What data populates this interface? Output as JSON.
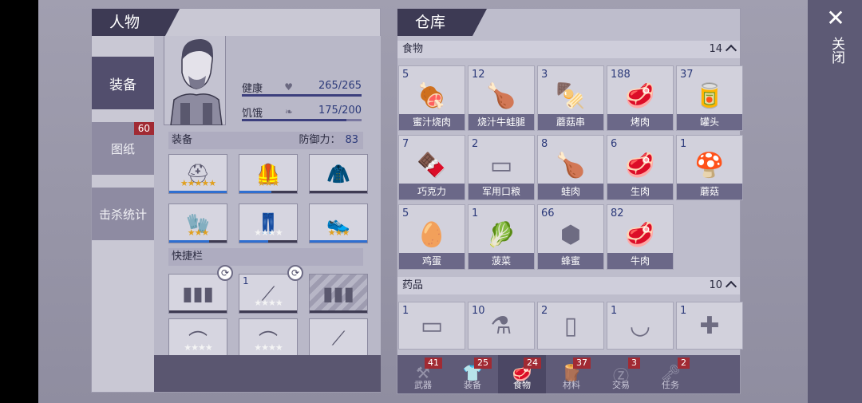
{
  "character": {
    "title": "人物",
    "tabs": [
      {
        "label": "装备",
        "active": true,
        "badge": ""
      },
      {
        "label": "图纸",
        "active": false,
        "badge": "60"
      },
      {
        "label": "击杀统计",
        "active": false,
        "badge": ""
      }
    ],
    "stats": {
      "health": {
        "label": "健康",
        "value": "265/265",
        "fraction": 1.0,
        "icon": "heart-icon"
      },
      "hunger": {
        "label": "饥饿",
        "value": "175/200",
        "fraction": 0.875,
        "icon": "stomach-icon"
      }
    },
    "equipment": {
      "label": "装备",
      "defense_label": "防御力：",
      "defense_value": "83",
      "slots": [
        {
          "item": "helmet-icon",
          "stars": "★★★★★",
          "gold": true,
          "durability": 1.0
        },
        {
          "item": "armor-vest-icon",
          "stars": "★★★",
          "gold": true,
          "durability": 0.55
        },
        {
          "item": "jacket-icon",
          "stars": "",
          "gold": false,
          "durability": 0
        },
        {
          "item": "gloves-icon",
          "stars": "★★★",
          "gold": true,
          "durability": 0.7
        },
        {
          "item": "pants-icon",
          "stars": "★★★★",
          "gold": false,
          "durability": 0.5
        },
        {
          "item": "shoes-icon",
          "stars": "★★★",
          "gold": true,
          "durability": 1.0
        }
      ]
    },
    "quickbar": {
      "label": "快捷栏",
      "slots": [
        {
          "item": "ammo-icon",
          "count": "",
          "stars": "",
          "durability": 0,
          "swap": true,
          "striped": false
        },
        {
          "item": "fire-spear-icon",
          "count": "1",
          "stars": "★★★★",
          "durability": 0,
          "swap": true,
          "striped": false
        },
        {
          "item": "ammo-icon",
          "count": "",
          "stars": "",
          "durability": 0,
          "swap": false,
          "striped": true
        },
        {
          "item": "bow-icon",
          "count": "",
          "stars": "★★★★",
          "durability": 0,
          "swap": false,
          "striped": false
        },
        {
          "item": "bow-icon",
          "count": "",
          "stars": "★★★★",
          "durability": 0.55,
          "swap": false,
          "striped": false
        },
        {
          "item": "machete-icon",
          "count": "",
          "stars": "",
          "durability": 0.12,
          "swap": false,
          "striped": false,
          "red": true
        }
      ]
    }
  },
  "warehouse": {
    "title": "仓库",
    "food": {
      "label": "食物",
      "count": "14",
      "items": [
        {
          "count": "5",
          "name": "蜜汁烧肉",
          "icon": "roast-meat-icon",
          "glyph": "🍖"
        },
        {
          "count": "12",
          "name": "烧汁牛蛙腿",
          "icon": "frog-legs-icon",
          "glyph": "🍗"
        },
        {
          "count": "3",
          "name": "蘑菇串",
          "icon": "mushroom-skewer-icon",
          "glyph": "🍢"
        },
        {
          "count": "188",
          "name": "烤肉",
          "icon": "grilled-meat-icon",
          "glyph": "🥩"
        },
        {
          "count": "37",
          "name": "罐头",
          "icon": "can-icon",
          "glyph": "🥫"
        },
        {
          "count": "7",
          "name": "巧克力",
          "icon": "chocolate-icon",
          "glyph": "🍫"
        },
        {
          "count": "2",
          "name": "军用口粮",
          "icon": "ration-icon",
          "glyph": "▭"
        },
        {
          "count": "8",
          "name": "蛙肉",
          "icon": "frog-meat-icon",
          "glyph": "🍗"
        },
        {
          "count": "6",
          "name": "生肉",
          "icon": "raw-meat-icon",
          "glyph": "🥩"
        },
        {
          "count": "1",
          "name": "蘑菇",
          "icon": "mushroom-icon",
          "glyph": "🍄"
        },
        {
          "count": "5",
          "name": "鸡蛋",
          "icon": "eggs-icon",
          "glyph": "🥚"
        },
        {
          "count": "1",
          "name": "菠菜",
          "icon": "spinach-icon",
          "glyph": "🥬"
        },
        {
          "count": "66",
          "name": "蜂蜜",
          "icon": "honeycomb-icon",
          "glyph": "⬢"
        },
        {
          "count": "82",
          "name": "牛肉",
          "icon": "beef-icon",
          "glyph": "🥩"
        }
      ]
    },
    "medicine": {
      "label": "药品",
      "count": "10",
      "items": [
        {
          "count": "1",
          "icon": "bandage-icon",
          "glyph": "▭"
        },
        {
          "count": "10",
          "icon": "bottle-icon",
          "glyph": "⚗"
        },
        {
          "count": "2",
          "icon": "pill-bottle-icon",
          "glyph": "▯"
        },
        {
          "count": "1",
          "icon": "mortar-icon",
          "glyph": "◡"
        },
        {
          "count": "1",
          "icon": "first-aid-kit-icon",
          "glyph": "✚"
        }
      ]
    },
    "bottom_tabs": [
      {
        "label": "武器",
        "badge": "41",
        "icon": "axe-icon",
        "glyph": "⚒",
        "active": false
      },
      {
        "label": "装备",
        "badge": "25",
        "icon": "shirt-icon",
        "glyph": "👕",
        "active": false
      },
      {
        "label": "食物",
        "badge": "24",
        "icon": "meat-icon",
        "glyph": "🥩",
        "active": true
      },
      {
        "label": "材料",
        "badge": "37",
        "icon": "material-icon",
        "glyph": "🪵",
        "active": false
      },
      {
        "label": "交易",
        "badge": "3",
        "icon": "coin-icon",
        "glyph": "Ⓩ",
        "active": false
      },
      {
        "label": "任务",
        "badge": "2",
        "icon": "key-icon",
        "glyph": "🗝",
        "active": false
      }
    ]
  },
  "close": {
    "label": "关闭",
    "icon": "close-icon"
  },
  "colors": {
    "accent": "#3d3a54",
    "badge": "#a12a33",
    "stat_blue": "#2c3a7a"
  }
}
